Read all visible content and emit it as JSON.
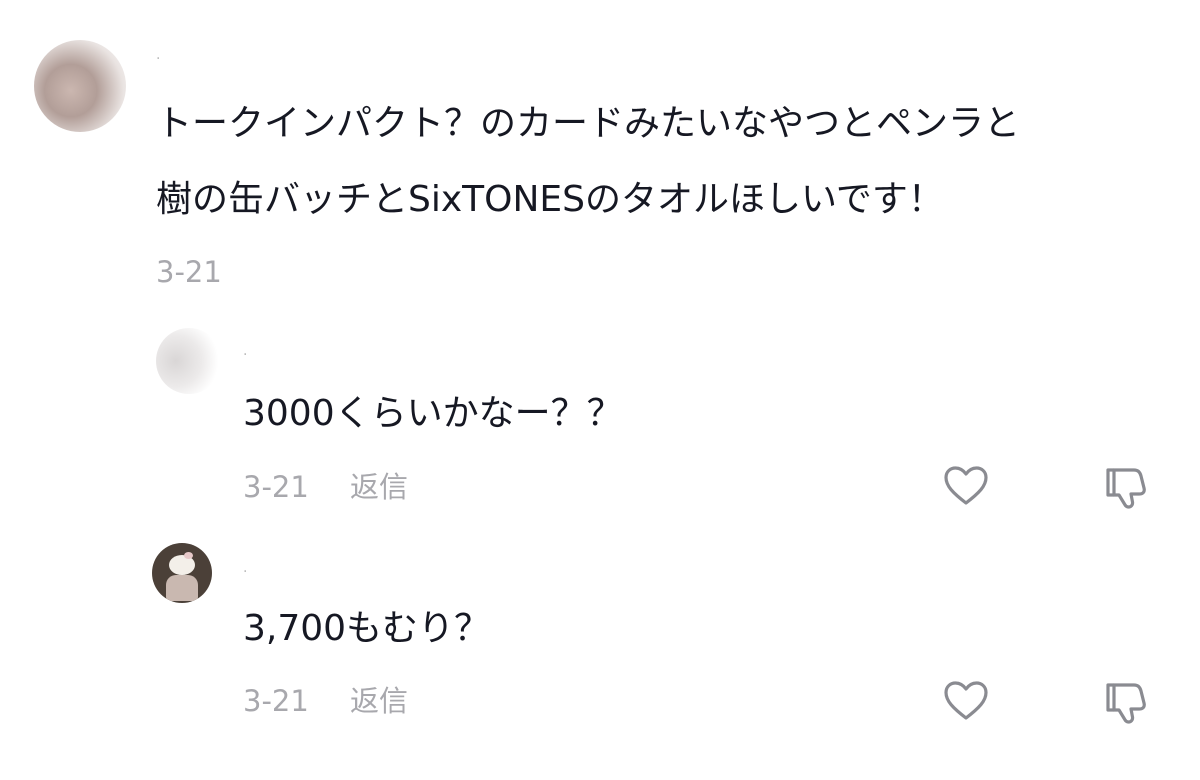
{
  "main_comment": {
    "line1": "トークインパクト？のカードみたいなやつとペンラと",
    "line2": "樹の缶バッチとSixTONESのタオルほしいです！",
    "date": "3-21"
  },
  "replies": [
    {
      "text": "3000くらいかなー？？",
      "date": "3-21",
      "reply_label": "返信",
      "like_icon": "heart-outline-icon",
      "dislike_icon": "thumbs-down-outline-icon"
    },
    {
      "text": "3,700もむり？",
      "date": "3-21",
      "reply_label": "返信",
      "like_icon": "heart-outline-icon",
      "dislike_icon": "thumbs-down-outline-icon"
    }
  ],
  "colors": {
    "text": "#161823",
    "meta": "#a8a8ad",
    "icon": "#8a8b91"
  }
}
